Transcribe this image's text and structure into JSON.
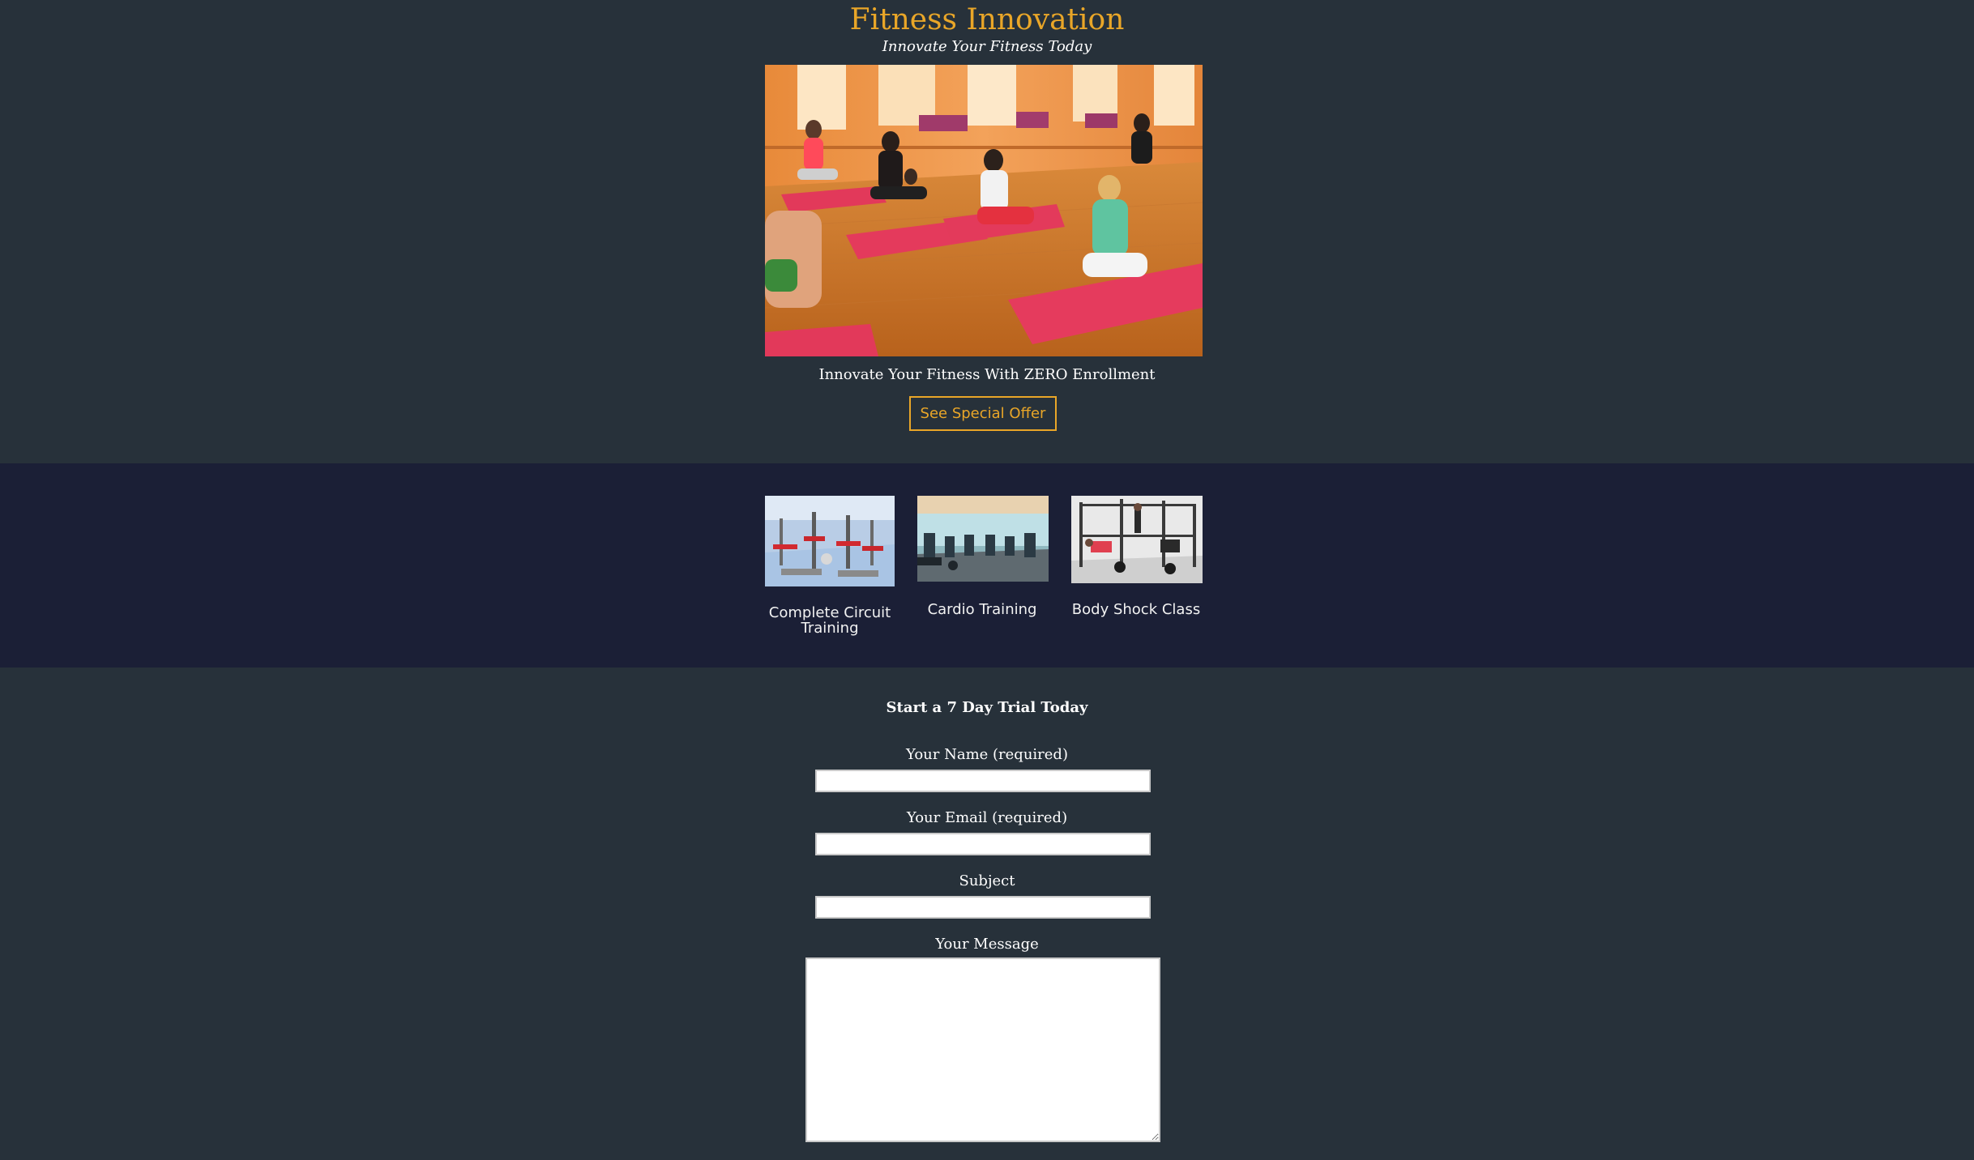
{
  "header": {
    "title": "Fitness Innovation",
    "tagline": "Innovate Your Fitness Today"
  },
  "hero": {
    "image_alt": "Yoga class on red mats",
    "caption": "Innovate Your Fitness With ZERO Enrollment",
    "offer_button": "See Special Offer"
  },
  "classes": [
    {
      "label_line1": "Complete Circuit",
      "label_line2": "Training",
      "image_alt": "Circuit training gym"
    },
    {
      "label_line1": "Cardio Training",
      "label_line2": "",
      "image_alt": "Cardio machines"
    },
    {
      "label_line1": "Body Shock Class",
      "label_line2": "",
      "image_alt": "Body shock class"
    }
  ],
  "trial_form": {
    "title": "Start a 7 Day Trial Today",
    "name_label": "Your Name (required)",
    "name_value": "",
    "email_label": "Your Email (required)",
    "email_value": "",
    "subject_label": "Subject",
    "subject_value": "",
    "message_label": "Your Message",
    "message_value": ""
  },
  "colors": {
    "page_bg": "#27313a",
    "band_bg": "#1b1f36",
    "accent": "#e9a628"
  }
}
